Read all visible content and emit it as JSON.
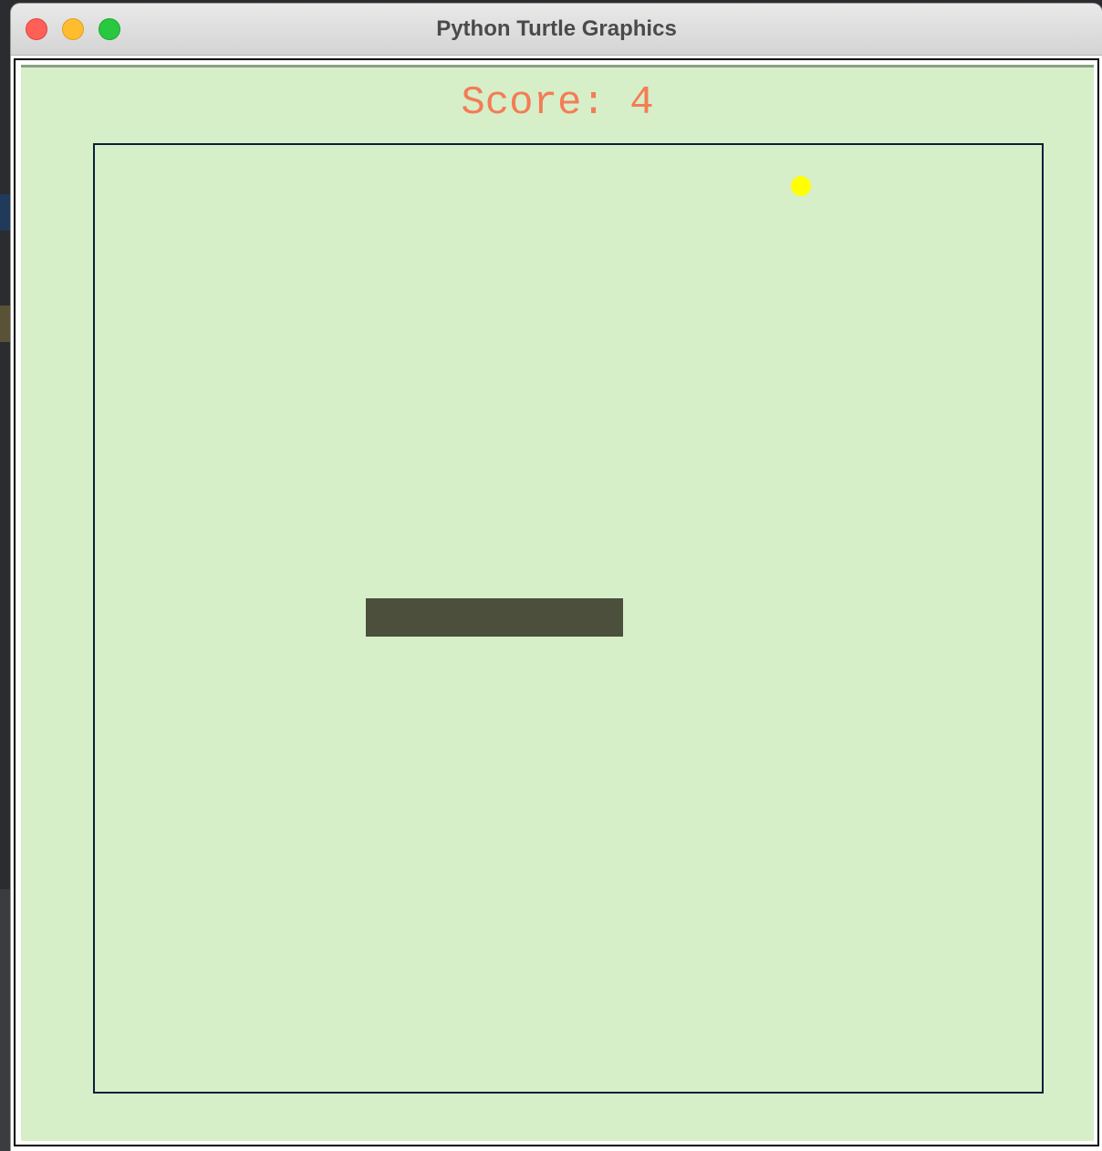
{
  "window": {
    "title": "Python Turtle Graphics"
  },
  "game": {
    "score_text": "Score: 4",
    "colors": {
      "background": "#d6efc8",
      "score": "#f47c55",
      "boundary": "#0a1f3a",
      "food": "#ffff00",
      "snake": "#4b4f3c"
    }
  }
}
